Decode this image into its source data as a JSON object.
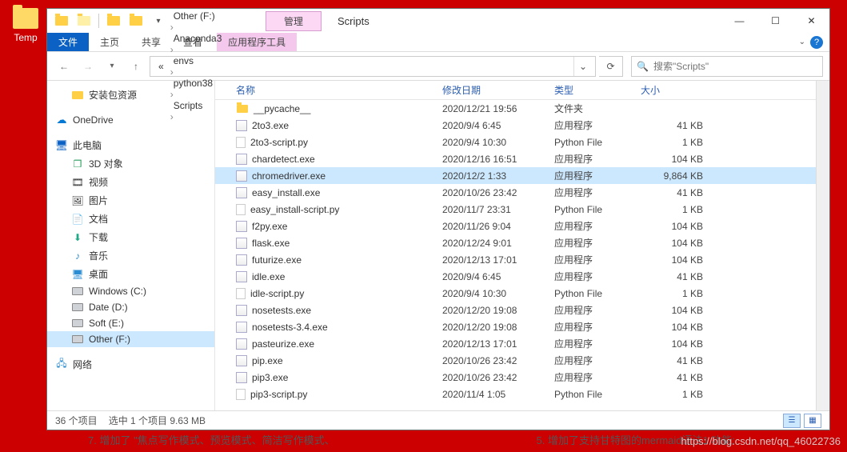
{
  "desktop": {
    "temp_label": "Temp"
  },
  "titlebar": {
    "manage_tab": "管理",
    "title": "Scripts"
  },
  "ribbon": {
    "file": "文件",
    "home": "主页",
    "share": "共享",
    "view": "查看",
    "tool": "应用程序工具"
  },
  "breadcrumb": {
    "items": [
      "Other (F:)",
      "Anaconda3",
      "envs",
      "python38",
      "Scripts"
    ]
  },
  "search": {
    "placeholder": "搜索\"Scripts\""
  },
  "sidebar": {
    "pkg": "安装包资源",
    "onedrive": "OneDrive",
    "thispc": "此电脑",
    "obj3d": "3D 对象",
    "videos": "视频",
    "pictures": "图片",
    "documents": "文档",
    "downloads": "下载",
    "music": "音乐",
    "desktop": "桌面",
    "cdrive": "Windows (C:)",
    "ddrive": "Date (D:)",
    "edrive": "Soft (E:)",
    "fdrive": "Other (F:)",
    "network": "网络"
  },
  "columns": {
    "name": "名称",
    "date": "修改日期",
    "type": "类型",
    "size": "大小"
  },
  "files": [
    {
      "name": "__pycache__",
      "date": "2020/12/21 19:56",
      "type": "文件夹",
      "size": "",
      "icon": "folder",
      "sel": false
    },
    {
      "name": "2to3.exe",
      "date": "2020/9/4 6:45",
      "type": "应用程序",
      "size": "41 KB",
      "icon": "exe",
      "sel": false
    },
    {
      "name": "2to3-script.py",
      "date": "2020/9/4 10:30",
      "type": "Python File",
      "size": "1 KB",
      "icon": "py",
      "sel": false
    },
    {
      "name": "chardetect.exe",
      "date": "2020/12/16 16:51",
      "type": "应用程序",
      "size": "104 KB",
      "icon": "exe",
      "sel": false
    },
    {
      "name": "chromedriver.exe",
      "date": "2020/12/2 1:33",
      "type": "应用程序",
      "size": "9,864 KB",
      "icon": "exe",
      "sel": true
    },
    {
      "name": "easy_install.exe",
      "date": "2020/10/26 23:42",
      "type": "应用程序",
      "size": "41 KB",
      "icon": "exe",
      "sel": false
    },
    {
      "name": "easy_install-script.py",
      "date": "2020/11/7 23:31",
      "type": "Python File",
      "size": "1 KB",
      "icon": "py",
      "sel": false
    },
    {
      "name": "f2py.exe",
      "date": "2020/11/26 9:04",
      "type": "应用程序",
      "size": "104 KB",
      "icon": "exe",
      "sel": false
    },
    {
      "name": "flask.exe",
      "date": "2020/12/24 9:01",
      "type": "应用程序",
      "size": "104 KB",
      "icon": "exe",
      "sel": false
    },
    {
      "name": "futurize.exe",
      "date": "2020/12/13 17:01",
      "type": "应用程序",
      "size": "104 KB",
      "icon": "exe",
      "sel": false
    },
    {
      "name": "idle.exe",
      "date": "2020/9/4 6:45",
      "type": "应用程序",
      "size": "41 KB",
      "icon": "exe",
      "sel": false
    },
    {
      "name": "idle-script.py",
      "date": "2020/9/4 10:30",
      "type": "Python File",
      "size": "1 KB",
      "icon": "py",
      "sel": false
    },
    {
      "name": "nosetests.exe",
      "date": "2020/12/20 19:08",
      "type": "应用程序",
      "size": "104 KB",
      "icon": "exe",
      "sel": false
    },
    {
      "name": "nosetests-3.4.exe",
      "date": "2020/12/20 19:08",
      "type": "应用程序",
      "size": "104 KB",
      "icon": "exe",
      "sel": false
    },
    {
      "name": "pasteurize.exe",
      "date": "2020/12/13 17:01",
      "type": "应用程序",
      "size": "104 KB",
      "icon": "exe",
      "sel": false
    },
    {
      "name": "pip.exe",
      "date": "2020/10/26 23:42",
      "type": "应用程序",
      "size": "41 KB",
      "icon": "exe",
      "sel": false
    },
    {
      "name": "pip3.exe",
      "date": "2020/10/26 23:42",
      "type": "应用程序",
      "size": "41 KB",
      "icon": "exe",
      "sel": false
    },
    {
      "name": "pip3-script.py",
      "date": "2020/11/4 1:05",
      "type": "Python File",
      "size": "1 KB",
      "icon": "py",
      "sel": false
    }
  ],
  "status": {
    "count": "36 个项目",
    "selection": "选中 1 个项目  9.63 MB"
  },
  "below": {
    "left": "7. 增加了 \"焦点写作模式、预览模式、简洁写作模式、",
    "right": "5. 增加了支持甘特图的mermaid语法1 功能:"
  },
  "watermark": "https://blog.csdn.net/qq_46022736"
}
